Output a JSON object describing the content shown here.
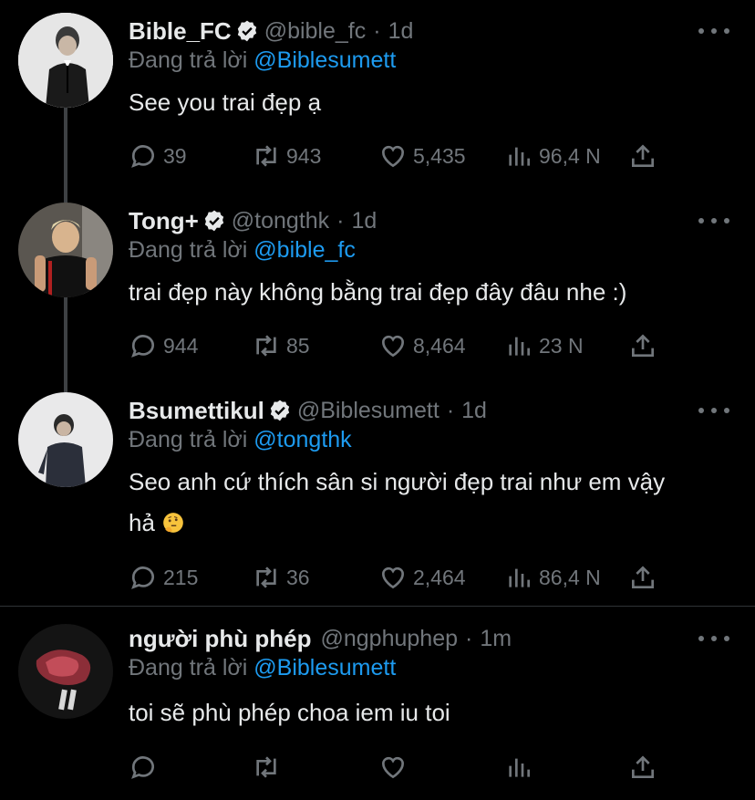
{
  "tweets": [
    {
      "name": "Bible_FC",
      "handle": "@bible_fc",
      "time": "1d",
      "reply_prefix": "Đang trả lời ",
      "reply_to": "@Biblesumett",
      "text": "See you trai đẹp ạ",
      "replies": "39",
      "retweets": "943",
      "likes": "5,435",
      "views": "96,4 N"
    },
    {
      "name": "Tong+",
      "handle": "@tongthk",
      "time": "1d",
      "reply_prefix": "Đang trả lời ",
      "reply_to": "@bible_fc",
      "text": "trai đẹp này không bằng trai đẹp đây đâu nhe :)",
      "replies": "944",
      "retweets": "85",
      "likes": "8,464",
      "views": "23 N"
    },
    {
      "name": "Bsumettikul",
      "handle": "@Biblesumett",
      "time": "1d",
      "reply_prefix": "Đang trả lời ",
      "reply_to": "@tongthk",
      "text_line1": "Seo anh cứ thích sân si người đẹp trai như em vậy",
      "text_line2": "hả",
      "replies": "215",
      "retweets": "36",
      "likes": "2,464",
      "views": "86,4 N"
    },
    {
      "name": "người phù phép",
      "handle": "@ngphuphep",
      "time": "1m",
      "reply_prefix": "Đang trả lời ",
      "reply_to": "@Biblesumett",
      "text": "toi sẽ phù phép choa iem iu toi"
    }
  ],
  "separator": "·",
  "icons": {
    "reply": "reply-icon",
    "retweet": "retweet-icon",
    "like": "heart-icon",
    "views": "views-icon",
    "share": "share-icon",
    "more": "more-icon",
    "verified": "verified-badge-icon"
  },
  "colors": {
    "background": "#000000",
    "text": "#e7e9ea",
    "muted": "#71767b",
    "mention": "#1d9bf0",
    "thread_line": "#3e4144"
  }
}
